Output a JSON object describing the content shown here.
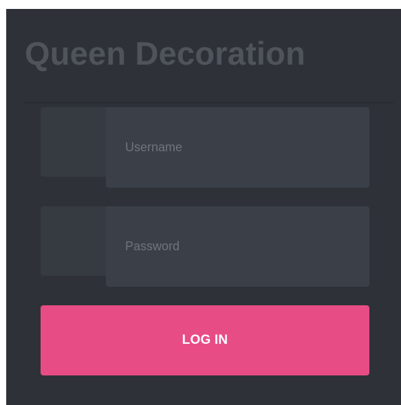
{
  "header": {
    "title": "Queen Decoration"
  },
  "form": {
    "username": {
      "placeholder": "Username",
      "value": ""
    },
    "password": {
      "placeholder": "Password",
      "value": ""
    },
    "submit_label": "LOG IN"
  },
  "colors": {
    "panel_background": "#2e3238",
    "title_text": "#4f545b",
    "input_background": "#3b4048",
    "icon_box_background": "#363a41",
    "placeholder_text": "#6f747c",
    "button_accent": "#e84c85",
    "button_text": "#ffffff"
  }
}
